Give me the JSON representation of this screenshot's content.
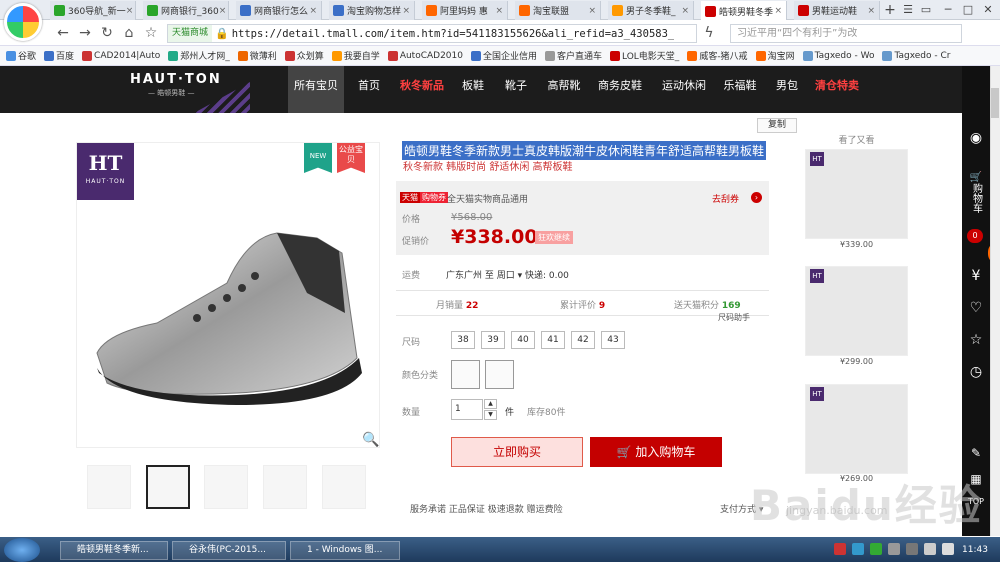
{
  "browser": {
    "tabs": [
      {
        "label": "360导航_新一",
        "color": "#2aa52a"
      },
      {
        "label": "网商银行_360",
        "color": "#2aa52a"
      },
      {
        "label": "网商银行怎么",
        "color": "#3b6fc7"
      },
      {
        "label": "淘宝购物怎样",
        "color": "#3b6fc7"
      },
      {
        "label": "阿里妈妈 惠",
        "color": "#f60"
      },
      {
        "label": "淘宝联盟",
        "color": "#f60"
      },
      {
        "label": "男子冬季鞋_",
        "color": "#f90"
      },
      {
        "label": "皓顿男鞋冬季",
        "color": "#c00"
      },
      {
        "label": "男鞋运动鞋",
        "color": "#c00"
      }
    ],
    "active_tab": 7,
    "new_tab": "+",
    "site_badge": "天猫商城",
    "url": "https://detail.tmall.com/item.htm?id=541183155626&ali_refid=a3_430583_",
    "search_placeholder": "习近平用“四个有利于”为改",
    "bookmarks": [
      "谷歌",
      "百度",
      "CAD2014|Auto",
      "郑州人才网_",
      "微薄利",
      "众划算",
      "我要自学",
      "AutoCAD2010",
      "全国企业信用",
      "客户直通车",
      "LOL电影天堂_",
      "威客-猪八戒",
      "淘宝网",
      "Tagxedo - Wo",
      "Tagxedo - Cr"
    ]
  },
  "site": {
    "brand": "HAUT·TON",
    "brand_sub": "— 皓顿男鞋 —",
    "nav": [
      "所有宝贝",
      "首页",
      "秋冬新品",
      "板鞋",
      "靴子",
      "高帮靴",
      "商务皮鞋",
      "运动休闲",
      "乐福鞋",
      "男包",
      "清仓特卖"
    ]
  },
  "sidebar": {
    "cart": "购物车",
    "cart_count": "0",
    "badge": "76",
    "top": "TOP"
  },
  "product": {
    "logo_letters": "HT",
    "logo_name": "HAUT·TON",
    "tag_new": "NEW",
    "tag_charity": "公益宝贝",
    "copy": "复制",
    "title": "皓顿男鞋冬季新款男士真皮韩版潮牛皮休闲鞋青年舒适高帮鞋男板鞋",
    "subtitle": "秋冬新款 韩版时尚 舒适休闲 高帮板鞋",
    "tmall_badge": "天猫",
    "tmall_badge2": "购物券",
    "tmall_text": "全天猫实物商品通用",
    "coupon": "去刮券",
    "price_label": "价格",
    "old_price": "¥568.00",
    "promo_label": "促销价",
    "new_price": "¥338.00",
    "promo_tag": "狂欢继续",
    "ship_label": "运费",
    "ship_text": "广东广州  至 周口 ▾  快递: 0.00",
    "monthly_label": "月销量",
    "monthly_value": "22",
    "reviews_label": "累计评价",
    "reviews_value": "9",
    "points_label": "送天猫积分",
    "points_value": "169",
    "size_helper": "尺码助手",
    "size_label": "尺码",
    "sizes": [
      "38",
      "39",
      "40",
      "41",
      "42",
      "43"
    ],
    "color_label": "颜色分类",
    "qty_label": "数量",
    "qty_value": "1",
    "qty_unit": "件",
    "stock": "库存80件",
    "buy_now": "立即购买",
    "add_cart": "加入购物车",
    "services": "服务承诺    正品保证      极速退款      赠运费险",
    "payment": "支付方式 ▾"
  },
  "recommend": {
    "header": "看了又看",
    "items": [
      {
        "price": "¥339.00"
      },
      {
        "price": "¥299.00"
      },
      {
        "price": "¥269.00"
      }
    ]
  },
  "watermark": {
    "text": "Baidu经验",
    "url": "jingyan.baidu.com"
  },
  "taskbar": {
    "tasks": [
      "皓顿男鞋冬季新...",
      "谷永伟(PC-2015...",
      "1 - Windows 图..."
    ],
    "clock": "11:43"
  }
}
